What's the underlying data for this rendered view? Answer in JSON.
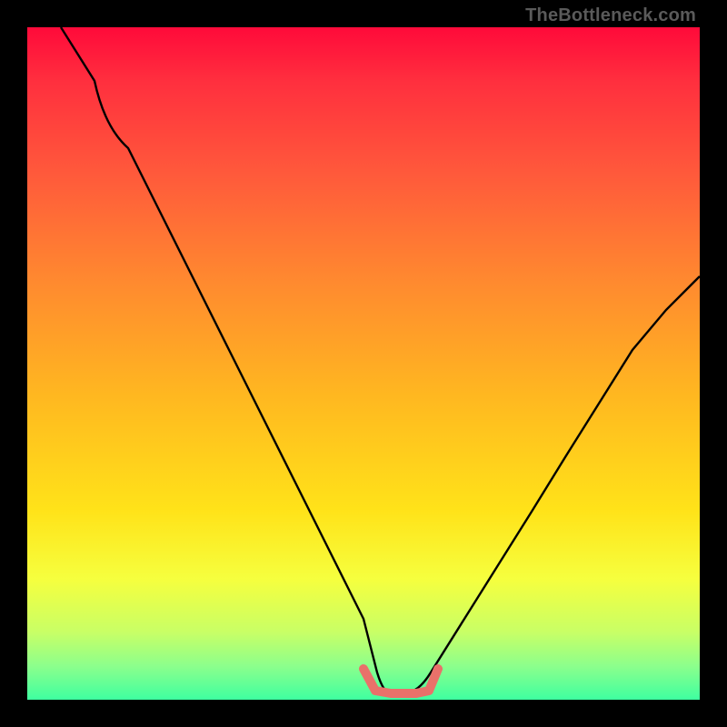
{
  "watermark": "TheBottleneck.com",
  "chart_data": {
    "type": "line",
    "title": "",
    "xlabel": "",
    "ylabel": "",
    "xlim": [
      0,
      100
    ],
    "ylim": [
      0,
      100
    ],
    "grid": false,
    "series": [
      {
        "name": "bottleneck-curve",
        "color": "#000000",
        "x": [
          5,
          10,
          15,
          20,
          25,
          30,
          35,
          40,
          45,
          50,
          52,
          54,
          56,
          58,
          60,
          65,
          70,
          75,
          80,
          85,
          90,
          95,
          100
        ],
        "y": [
          100,
          92,
          82,
          72,
          62,
          52,
          42,
          32,
          22,
          12,
          4,
          1,
          1,
          1,
          4,
          12,
          20,
          28,
          36,
          44,
          52,
          58,
          63
        ]
      },
      {
        "name": "optimal-range-marker",
        "color": "#e9716a",
        "x": [
          50,
          52,
          54,
          56,
          58,
          60
        ],
        "y": [
          4,
          1,
          1,
          1,
          1,
          4
        ]
      }
    ],
    "background_gradient": {
      "top": "#ff0a3a",
      "bottom": "#3effa0",
      "meaning": "red = high bottleneck, green = balanced"
    }
  },
  "colors": {
    "frame": "#000000",
    "watermark": "#5a5a5a",
    "curve": "#000000",
    "marker": "#e9716a"
  }
}
